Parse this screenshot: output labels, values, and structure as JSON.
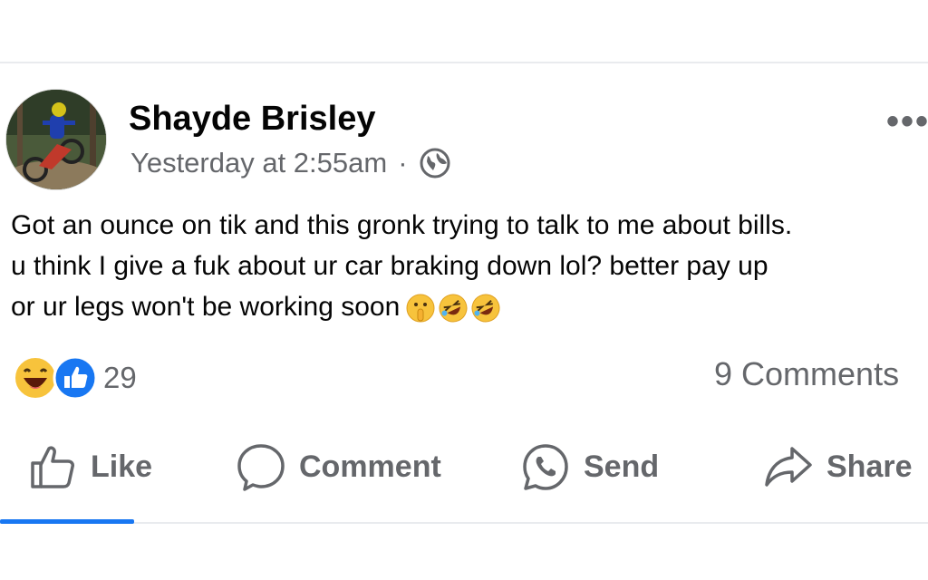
{
  "post": {
    "author": "Shayde Brisley",
    "timestamp": "Yesterday at 2:55am",
    "separator": "·",
    "privacy_icon": "globe-icon",
    "more_label": "•••",
    "text_line1": "Got an ounce on tik and this gronk trying to talk to me about bills.",
    "text_line2": "u think I give a fuk about ur car braking down lol? better pay up",
    "text_line3": "or ur legs won't be working soon",
    "emojis": [
      "shushing-face",
      "rolling-on-floor-laughing",
      "rolling-on-floor-laughing"
    ]
  },
  "reactions": {
    "icons": [
      "haha-reaction",
      "like-reaction"
    ],
    "count": "29",
    "comments": "9 Comments"
  },
  "actions": {
    "like": "Like",
    "comment": "Comment",
    "send": "Send",
    "share": "Share"
  },
  "colors": {
    "text": "#050505",
    "secondary": "#65676b",
    "accent": "#1877f2",
    "divider": "#e9ebee"
  }
}
